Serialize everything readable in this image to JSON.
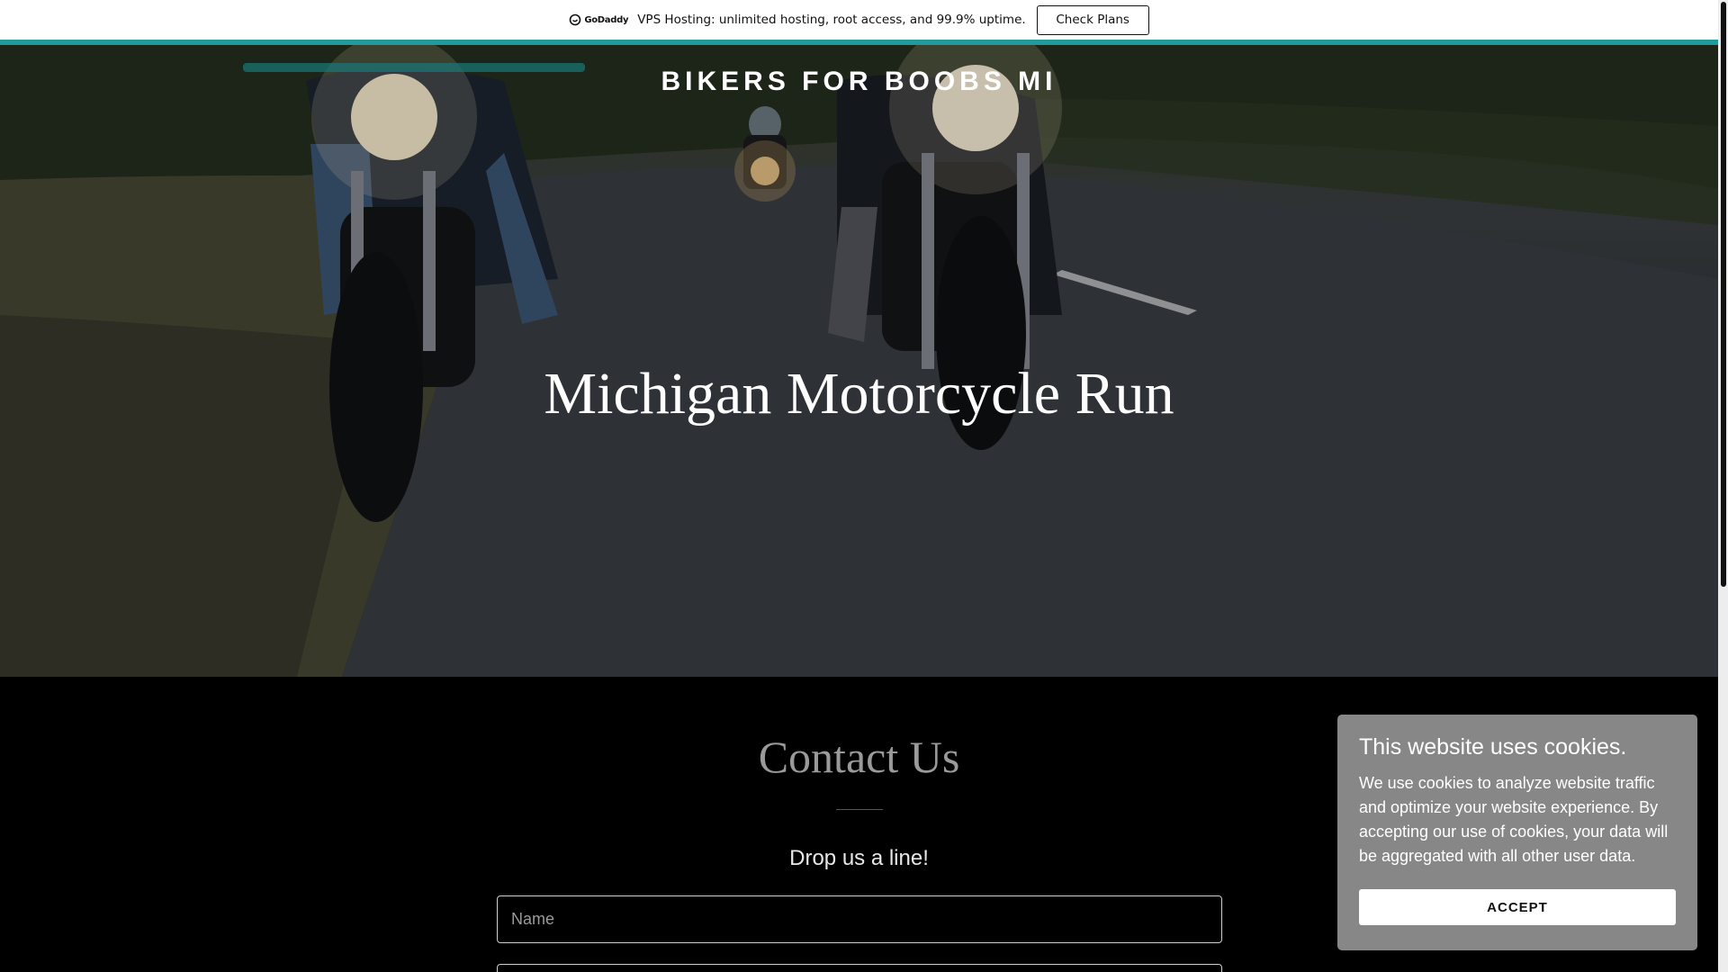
{
  "promo": {
    "brand": "GoDaddy",
    "text": "VPS Hosting: unlimited hosting, root access, and 99.9% uptime.",
    "button_label": "Check Plans"
  },
  "header": {
    "site_title": "BIKERS FOR BOOBS MI"
  },
  "hero": {
    "heading": "Michigan Motorcycle Run"
  },
  "contact": {
    "title": "Contact Us",
    "subtitle": "Drop us a line!",
    "name_placeholder": "Name",
    "second_field_placeholder": ""
  },
  "cookie": {
    "title": "This website uses cookies.",
    "body": "We use cookies to analyze website traffic and optimize your website experience. By accepting our use of cookies, your data will be aggregated with all other user data.",
    "accept_label": "ACCEPT"
  },
  "colors": {
    "accent": "#1f9a9d",
    "cookie_bg": "#878787"
  }
}
